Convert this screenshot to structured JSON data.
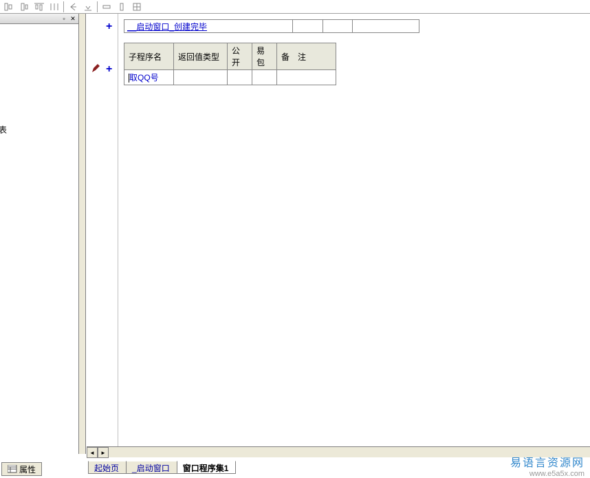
{
  "toolbar": {
    "icons": [
      "align-left",
      "align-center",
      "align-just",
      "distribute",
      "arrow-left",
      "arrow-down",
      "horizontal",
      "vertical",
      "grid"
    ]
  },
  "panel": {
    "side_text": "表"
  },
  "props_tab": {
    "label": "属性"
  },
  "row1": {
    "link": "__启动窗口_创建完毕"
  },
  "table2": {
    "headers": [
      "子程序名",
      "返回值类型",
      "公开",
      "易包",
      "备　注"
    ],
    "row": {
      "name": "取QQ号"
    }
  },
  "bottom_tabs": {
    "t1": "起始页",
    "t2": "_启动窗口",
    "t3": "窗口程序集1"
  },
  "watermark": {
    "cn": "易语言资源网",
    "en": "www.e5a5x.com"
  }
}
